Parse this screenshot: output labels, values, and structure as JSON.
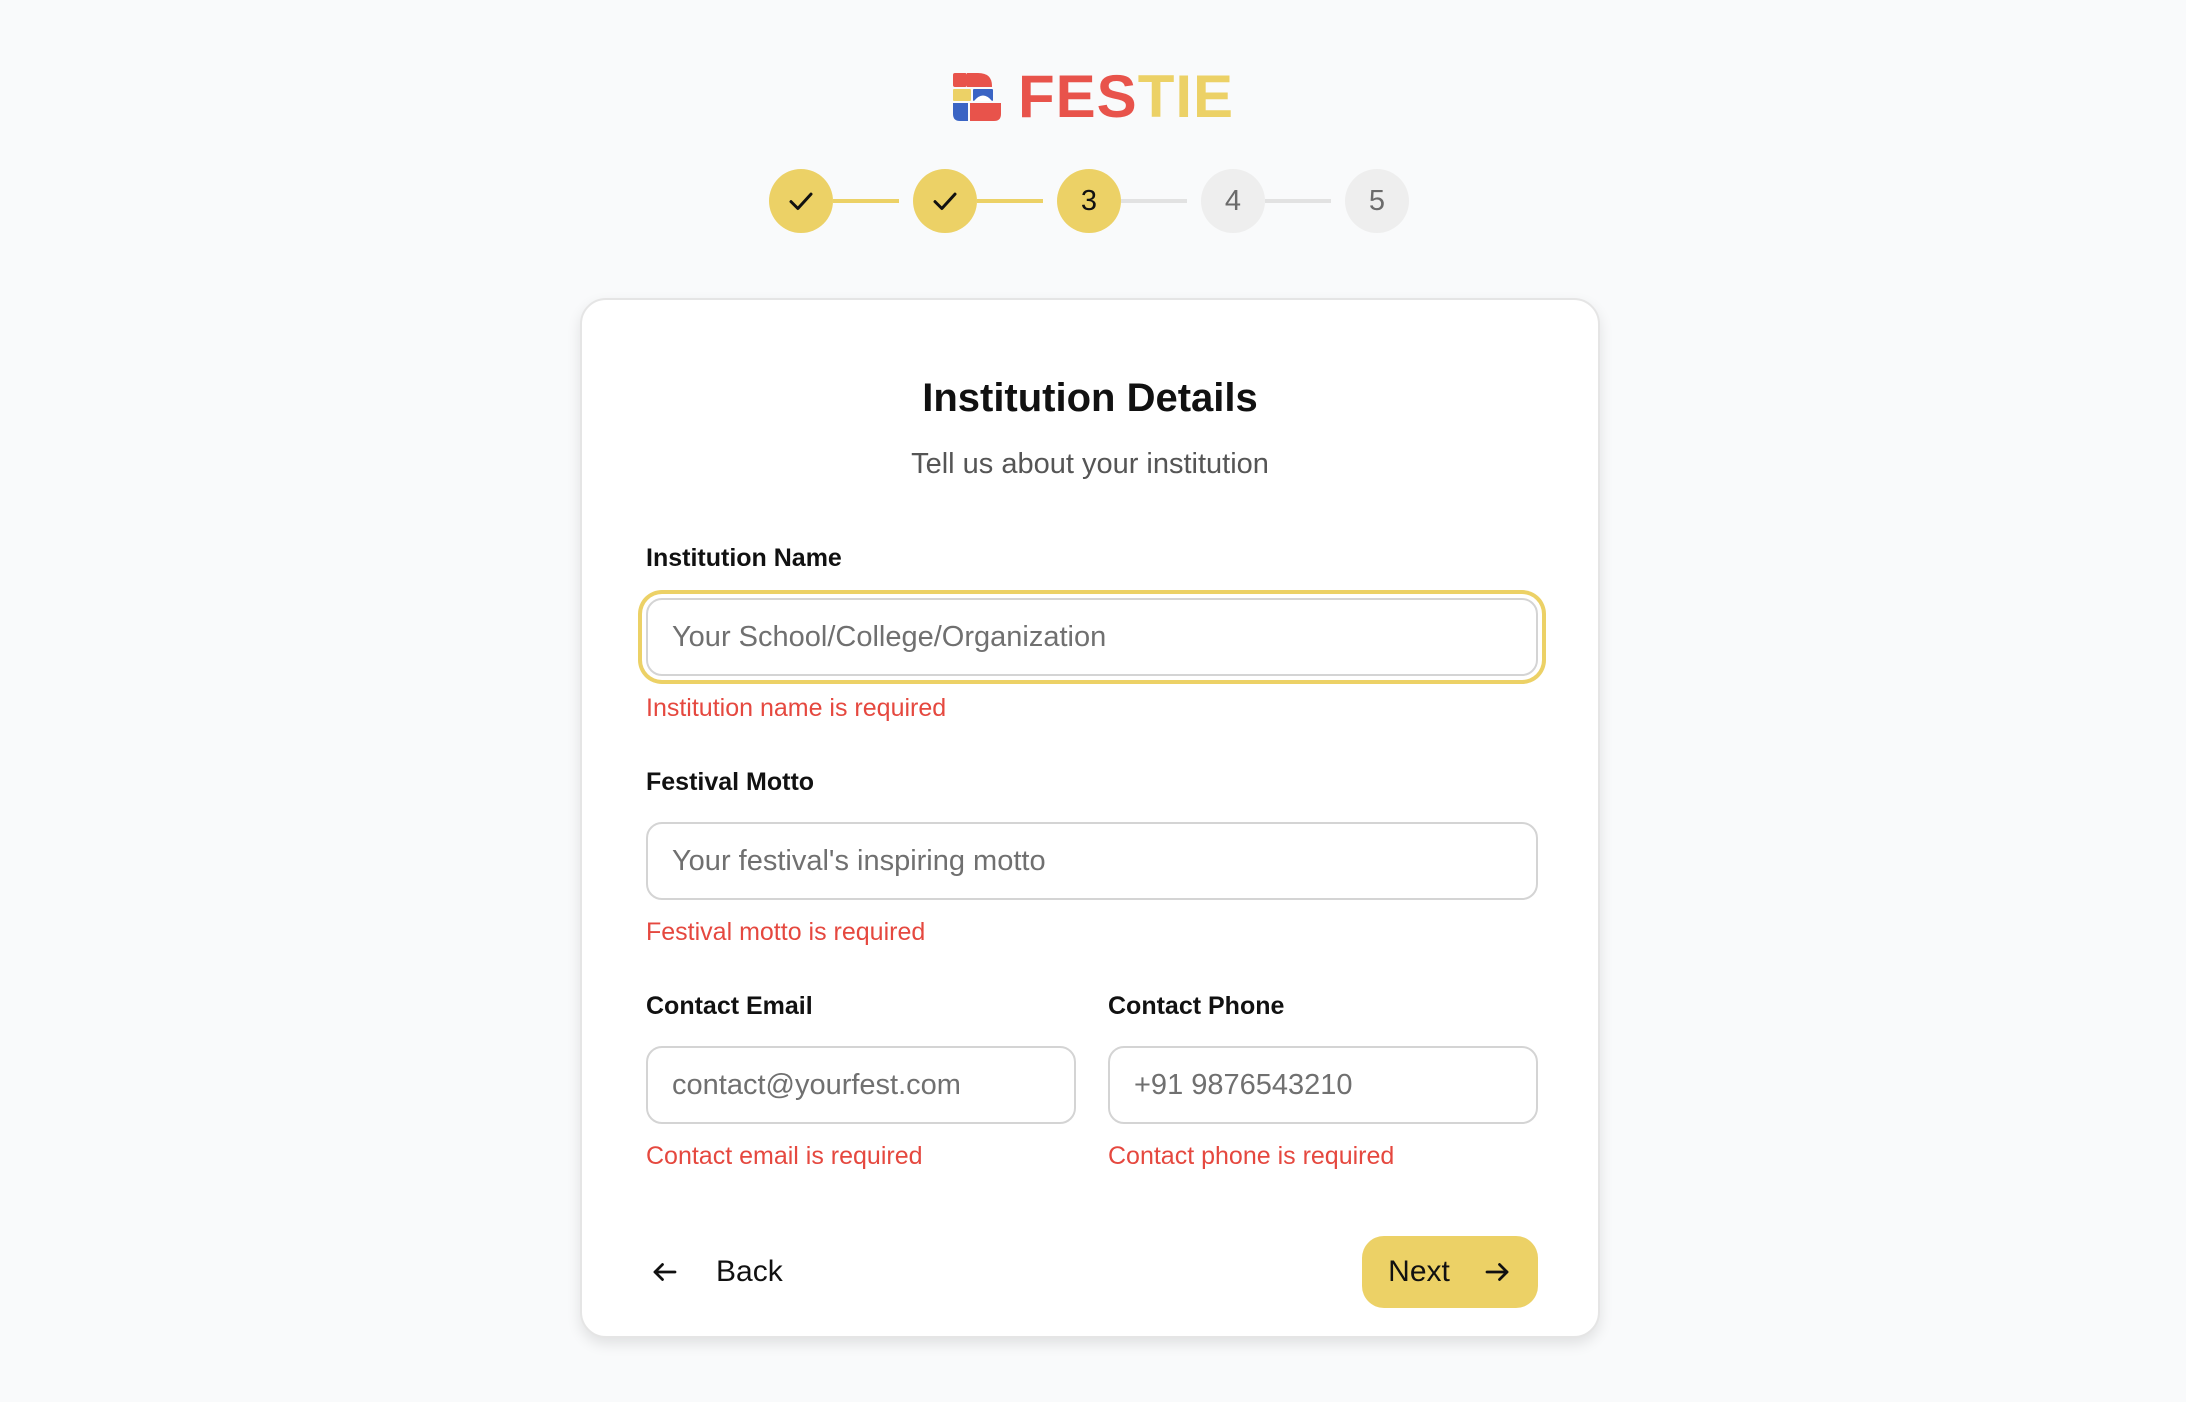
{
  "brand": {
    "name_part1": "FES",
    "name_part2": "TIE",
    "logo_icon": "festie-logo-icon",
    "colors": {
      "red": "#e8534b",
      "yellow": "#ecd166",
      "blue": "#3a64c4"
    }
  },
  "stepper": {
    "current_step": 3,
    "total_steps": 5,
    "steps": [
      {
        "label": "1",
        "status": "completed",
        "icon": "check-icon"
      },
      {
        "label": "2",
        "status": "completed",
        "icon": "check-icon"
      },
      {
        "label": "3",
        "status": "current"
      },
      {
        "label": "4",
        "status": "upcoming"
      },
      {
        "label": "5",
        "status": "upcoming"
      }
    ]
  },
  "form": {
    "title": "Institution Details",
    "subtitle": "Tell us about your institution",
    "fields": {
      "institution_name": {
        "label": "Institution Name",
        "value": "",
        "placeholder": "Your School/College/Organization",
        "error": "Institution name is required",
        "focused": true
      },
      "festival_motto": {
        "label": "Festival Motto",
        "value": "",
        "placeholder": "Your festival's inspiring motto",
        "error": "Festival motto is required"
      },
      "contact_email": {
        "label": "Contact Email",
        "value": "",
        "placeholder": "contact@yourfest.com",
        "error": "Contact email is required"
      },
      "contact_phone": {
        "label": "Contact Phone",
        "value": "",
        "placeholder": "+91 9876543210",
        "error": "Contact phone is required"
      }
    },
    "actions": {
      "back_label": "Back",
      "back_icon": "arrow-left-icon",
      "next_label": "Next",
      "next_icon": "arrow-right-icon"
    },
    "colors": {
      "accent": "#ecd166",
      "error": "#e5483f"
    }
  }
}
